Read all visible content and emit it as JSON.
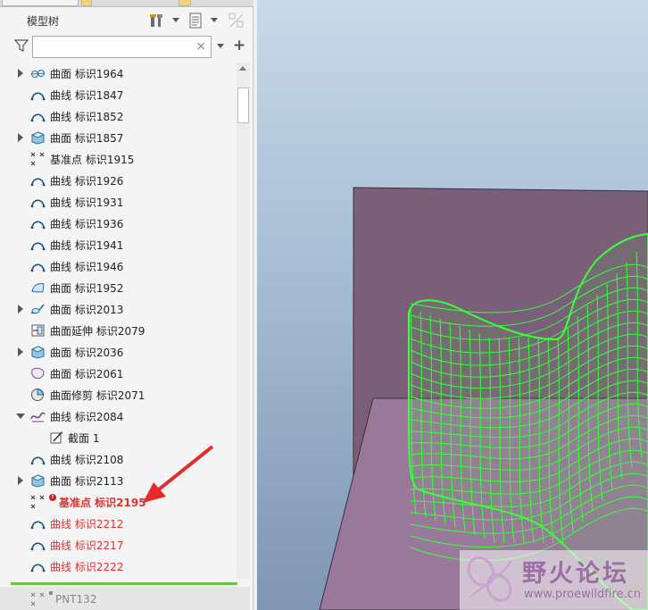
{
  "panel": {
    "title": "模型树",
    "search": {
      "value": "",
      "placeholder": ""
    },
    "clear_symbol": "×",
    "add_symbol": "+"
  },
  "tree": {
    "items": [
      {
        "label": "曲面 标识1964",
        "icon": "blend-surface-icon",
        "expandable": true,
        "status": "normal"
      },
      {
        "label": "曲线 标识1847",
        "icon": "curve-icon",
        "expandable": false,
        "status": "normal"
      },
      {
        "label": "曲线 标识1852",
        "icon": "curve-icon",
        "expandable": false,
        "status": "normal"
      },
      {
        "label": "曲面 标识1857",
        "icon": "solid-surface-icon",
        "expandable": true,
        "status": "normal"
      },
      {
        "label": "基准点 标识1915",
        "icon": "datum-point-icon",
        "expandable": false,
        "status": "normal"
      },
      {
        "label": "曲线 标识1926",
        "icon": "curve-icon",
        "expandable": false,
        "status": "normal"
      },
      {
        "label": "曲线 标识1931",
        "icon": "curve-icon",
        "expandable": false,
        "status": "normal"
      },
      {
        "label": "曲线 标识1936",
        "icon": "curve-icon",
        "expandable": false,
        "status": "normal"
      },
      {
        "label": "曲线 标识1941",
        "icon": "curve-icon",
        "expandable": false,
        "status": "normal"
      },
      {
        "label": "曲线 标识1946",
        "icon": "curve-icon",
        "expandable": false,
        "status": "normal"
      },
      {
        "label": "曲面 标识1952",
        "icon": "boundary-surface-icon",
        "expandable": false,
        "status": "normal"
      },
      {
        "label": "曲面 标识2013",
        "icon": "swept-surface-icon",
        "expandable": true,
        "status": "normal"
      },
      {
        "label": "曲面延伸 标识2079",
        "icon": "extend-icon",
        "expandable": false,
        "status": "normal"
      },
      {
        "label": "曲面 标识2036",
        "icon": "solid-surface-icon",
        "expandable": true,
        "status": "normal"
      },
      {
        "label": "曲面 标识2061",
        "icon": "fill-surface-icon",
        "expandable": false,
        "status": "normal"
      },
      {
        "label": "曲面修剪 标识2071",
        "icon": "trim-icon",
        "expandable": false,
        "status": "normal"
      },
      {
        "label": "曲线 标识2084",
        "icon": "sketch-curve-icon",
        "expandable": true,
        "expanded": true,
        "status": "normal"
      },
      {
        "label": "截面 1",
        "icon": "section-sketch-icon",
        "expandable": false,
        "status": "child"
      },
      {
        "label": "曲线 标识2108",
        "icon": "curve-icon",
        "expandable": false,
        "status": "normal"
      },
      {
        "label": "曲面 标识2113",
        "icon": "solid-surface-icon",
        "expandable": true,
        "status": "normal"
      },
      {
        "label": "基准点 标识2195",
        "icon": "datum-point-icon",
        "expandable": false,
        "status": "error-bold"
      },
      {
        "label": "曲线 标识2212",
        "icon": "curve-icon",
        "expandable": false,
        "status": "error"
      },
      {
        "label": "曲线 标识2217",
        "icon": "curve-icon",
        "expandable": false,
        "status": "error"
      },
      {
        "label": "曲线 标识2222",
        "icon": "curve-icon",
        "expandable": false,
        "status": "error"
      }
    ],
    "insert_row": {
      "label": "PNT132",
      "icon": "datum-point-icon"
    }
  },
  "annotation": {
    "type": "red-arrow",
    "points_to": "基准点 标识2195"
  },
  "viewport": {
    "background_top": "#c8d9e8",
    "background_bottom": "#7f96b3",
    "plane_color": "#7a5e78",
    "mesh_color": "#39ff39"
  },
  "watermark": {
    "title": "野火论坛",
    "url": "www.proewildfire.cn"
  },
  "colors": {
    "error_text": "#e03030",
    "insert_bar": "#6cc24a",
    "watermark": "#9b6fa6"
  }
}
